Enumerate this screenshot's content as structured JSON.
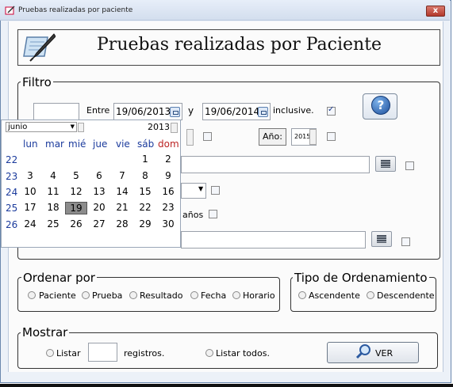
{
  "window": {
    "title": "Pruebas realizadas por paciente",
    "close_glyph": "x"
  },
  "header": {
    "title": "Pruebas realizadas por Paciente",
    "icon": "notepad-pen-icon"
  },
  "filter": {
    "legend": "Filtro",
    "entre_label": "Entre",
    "date_from": "19/06/2013",
    "y_label": "y",
    "date_to": "19/06/2014",
    "inclusive_label": "inclusive.",
    "inclusive_checked": true,
    "anio_label": "Año:",
    "anio_value": "2015",
    "anios_label": "años",
    "help_glyph": "?"
  },
  "calendar": {
    "month": "junio",
    "year": "2013",
    "weekdays": [
      "lun",
      "mar",
      "mié",
      "jue",
      "vie",
      "sáb",
      "dom"
    ],
    "weeks": [
      {
        "num": "22",
        "days": [
          "",
          "",
          "",
          "",
          "",
          "1",
          "2"
        ]
      },
      {
        "num": "23",
        "days": [
          "3",
          "4",
          "5",
          "6",
          "7",
          "8",
          "9"
        ]
      },
      {
        "num": "24",
        "days": [
          "10",
          "11",
          "12",
          "13",
          "14",
          "15",
          "16"
        ]
      },
      {
        "num": "25",
        "days": [
          "17",
          "18",
          "19",
          "20",
          "21",
          "22",
          "23"
        ]
      },
      {
        "num": "26",
        "days": [
          "24",
          "25",
          "26",
          "27",
          "28",
          "29",
          "30"
        ]
      }
    ],
    "selected_day": "19",
    "colors": {
      "weekday": "#1a3a9c",
      "sunday": "#b22222",
      "selected_bg": "#8c8c8c"
    }
  },
  "ordenar": {
    "legend": "Ordenar por",
    "options": [
      "Paciente",
      "Prueba",
      "Resultado",
      "Fecha",
      "Horario"
    ]
  },
  "tipo": {
    "legend": "Tipo de Ordenamiento",
    "options": [
      "Ascendente",
      "Descendente"
    ]
  },
  "mostrar": {
    "legend": "Mostrar",
    "listar_label": "Listar",
    "registros_label": "registros.",
    "listar_todos_label": "Listar todos.",
    "ver_label": "VER"
  }
}
